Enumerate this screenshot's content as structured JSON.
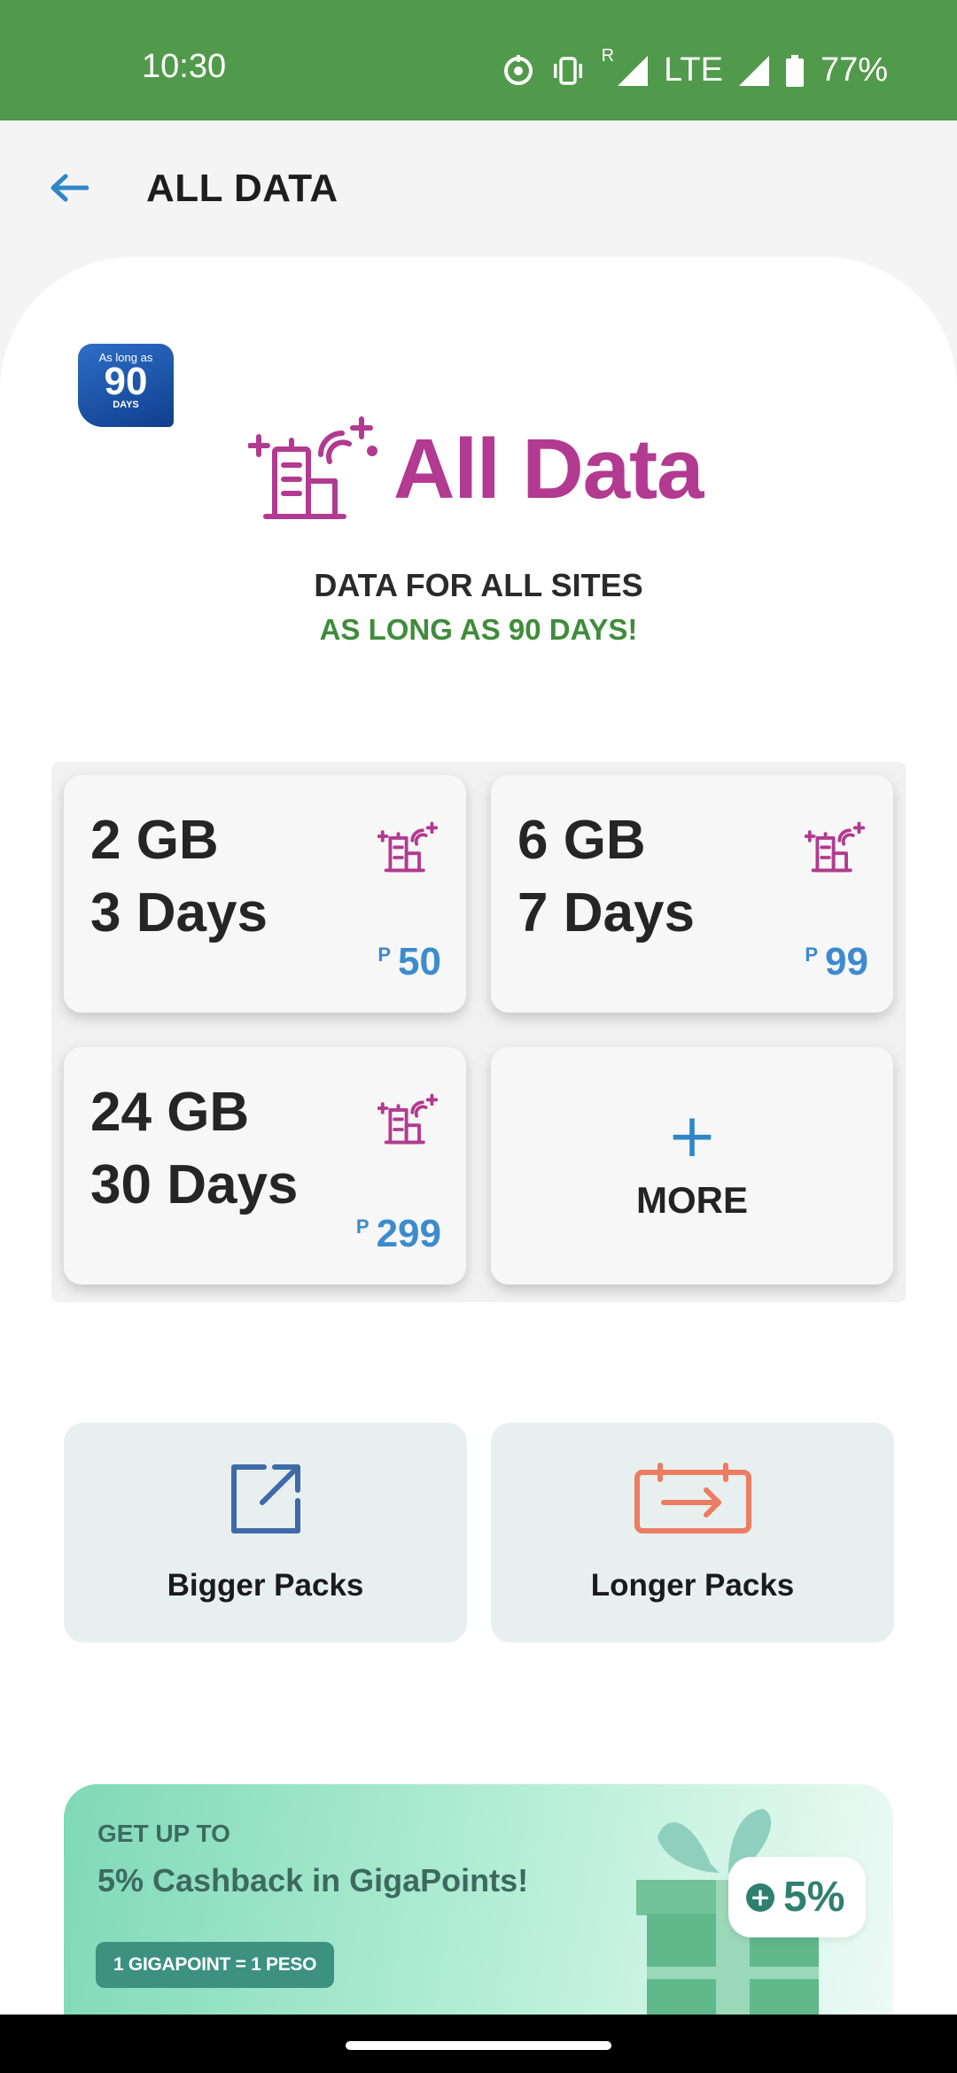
{
  "status_bar": {
    "time": "10:30",
    "roaming": "R",
    "network": "LTE",
    "battery": "77%"
  },
  "header": {
    "back_icon": "arrow-left-icon",
    "title": "ALL DATA"
  },
  "badge": {
    "top": "As long as",
    "number": "90",
    "bottom": "DAYS"
  },
  "hero": {
    "title": "All Data",
    "line1": "DATA FOR ALL SITES",
    "line2": "AS LONG AS 90 DAYS!"
  },
  "plans": [
    {
      "size": "2 GB",
      "days": "3 Days",
      "currency": "P",
      "price": "50"
    },
    {
      "size": "6 GB",
      "days": "7 Days",
      "currency": "P",
      "price": "99"
    },
    {
      "size": "24 GB",
      "days": "30 Days",
      "currency": "P",
      "price": "299"
    }
  ],
  "more": {
    "plus": "+",
    "label": "MORE"
  },
  "packs": {
    "bigger": "Bigger Packs",
    "longer": "Longer Packs"
  },
  "promo": {
    "kicker": "GET UP TO",
    "title": "5% Cashback in GigaPoints!",
    "chip": "1 GIGAPOINT = 1 PESO",
    "percent": "5%",
    "plus": "+"
  },
  "colors": {
    "status_green": "#519a4b",
    "accent_magenta": "#b23a91",
    "price_blue": "#3c8bd0",
    "subtitle_green": "#3f8c3a",
    "promo_teal": "#3c9181"
  }
}
